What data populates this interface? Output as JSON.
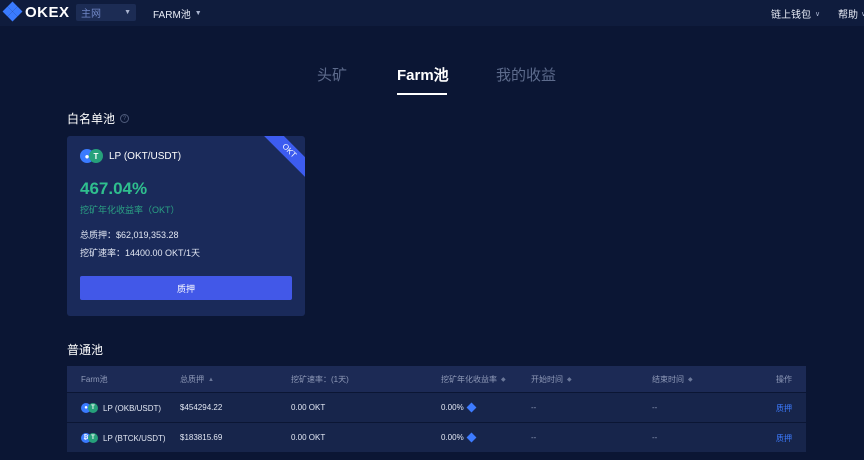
{
  "header": {
    "logo_text": "OKEX",
    "network_label": "主网",
    "farm_menu_label": "FARM池",
    "wallet_label": "链上钱包",
    "help_label": "帮助"
  },
  "tabs": [
    {
      "label": "头矿",
      "active": false
    },
    {
      "label": "Farm池",
      "active": true
    },
    {
      "label": "我的收益",
      "active": false
    }
  ],
  "whitelist": {
    "title": "白名单池",
    "card": {
      "ribbon": "OKT",
      "pair": "LP (OKT/USDT)",
      "coin_a": "●",
      "coin_b": "T",
      "apy": "467.04%",
      "apy_label": "挖矿年化收益率（OKT）",
      "total_staked": "总质押：$62,019,353.28",
      "mining_rate": "挖矿速率：14400.00 OKT/1天",
      "stake_button": "质押"
    }
  },
  "pools": {
    "title": "普通池",
    "headers": {
      "pool": "Farm池",
      "total": "总质押",
      "rate": "挖矿速率：(1天)",
      "apy": "挖矿年化收益率",
      "start": "开始时间",
      "end": "结束时间",
      "action": "操作"
    },
    "rows": [
      {
        "coin_a": "●",
        "coin_b": "T",
        "pair": "LP (OKB/USDT)",
        "total": "$454294.22",
        "rate": "0.00 OKT",
        "apy": "0.00%",
        "start": "--",
        "end": "--",
        "action": "质押"
      },
      {
        "coin_a": "₿",
        "coin_b": "T",
        "pair": "LP (BTCK/USDT)",
        "total": "$183815.69",
        "rate": "0.00 OKT",
        "apy": "0.00%",
        "start": "--",
        "end": "--",
        "action": "质押"
      }
    ]
  },
  "colors": {
    "background": "#0b1634",
    "card": "#1a2a5a",
    "accent": "#4258e8",
    "apy_green": "#2fbf8e",
    "link": "#3d7bff"
  }
}
